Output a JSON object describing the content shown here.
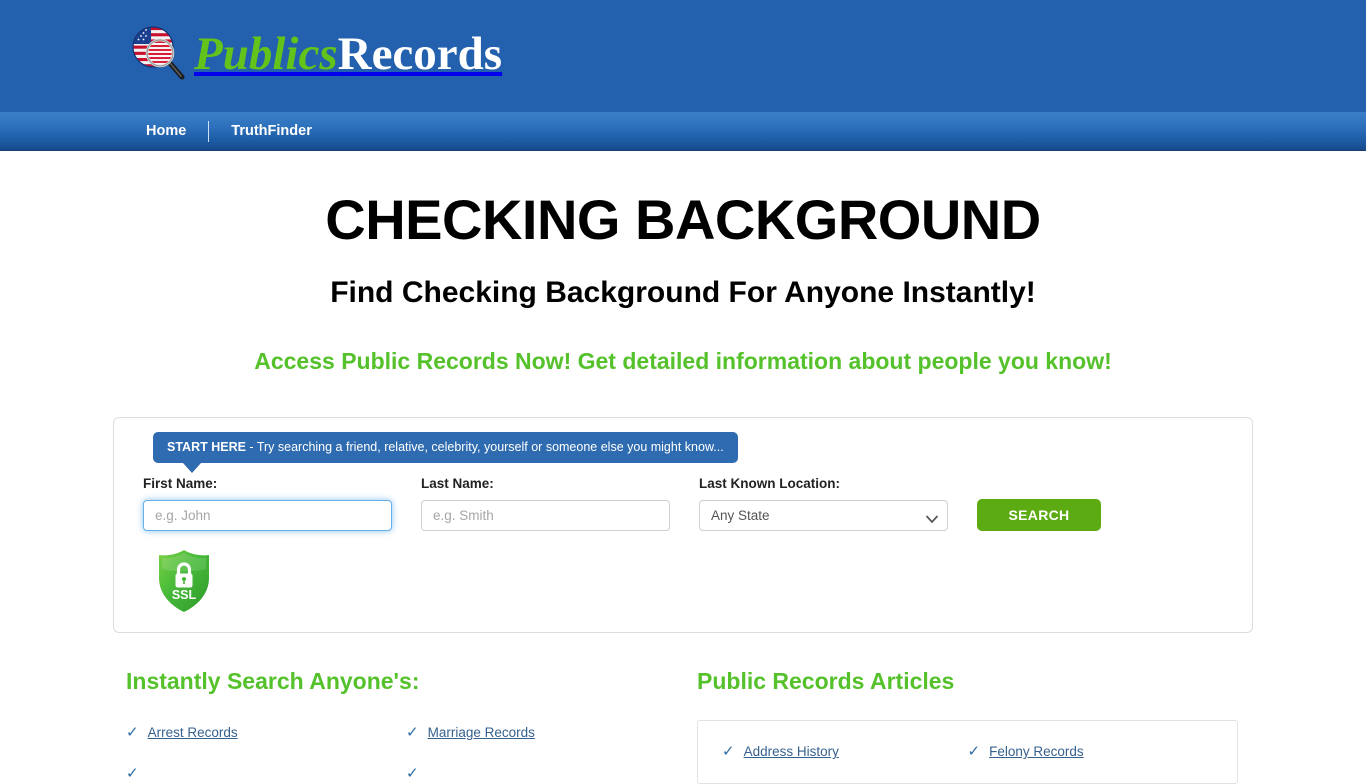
{
  "site": {
    "logo": {
      "icon": "flag-magnifier-icon",
      "text_green": "Publics",
      "text_white": "Records"
    },
    "brand_blue": "#2360ad",
    "brand_green": "#55c12b",
    "link_blue": "#36618e"
  },
  "nav": {
    "items": [
      {
        "label": "Home"
      },
      {
        "label": "TruthFinder"
      }
    ]
  },
  "hero": {
    "title": "CHECKING BACKGROUND",
    "subtitle": "Find Checking Background For Anyone Instantly!",
    "tagline": "Access Public Records Now! Get detailed information about people you know!"
  },
  "search": {
    "banner_strong": "START HERE",
    "banner_text": " - Try searching a friend, relative, celebrity, yourself or someone else you might know...",
    "first_name": {
      "label": "First Name:",
      "placeholder": "e.g. John",
      "value": ""
    },
    "last_name": {
      "label": "Last Name:",
      "placeholder": "e.g. Smith",
      "value": ""
    },
    "location": {
      "label": "Last Known Location:",
      "selected": "Any State",
      "options": [
        "Any State"
      ]
    },
    "submit_label": "SEARCH",
    "ssl_badge_label": "SSL"
  },
  "instant_search": {
    "title": "Instantly Search Anyone's:",
    "links": [
      {
        "label": "Arrest Records"
      },
      {
        "label": "Marriage Records"
      }
    ]
  },
  "articles": {
    "title": "Public Records Articles",
    "links": [
      {
        "label": "Address History"
      },
      {
        "label": "Felony Records"
      }
    ]
  }
}
